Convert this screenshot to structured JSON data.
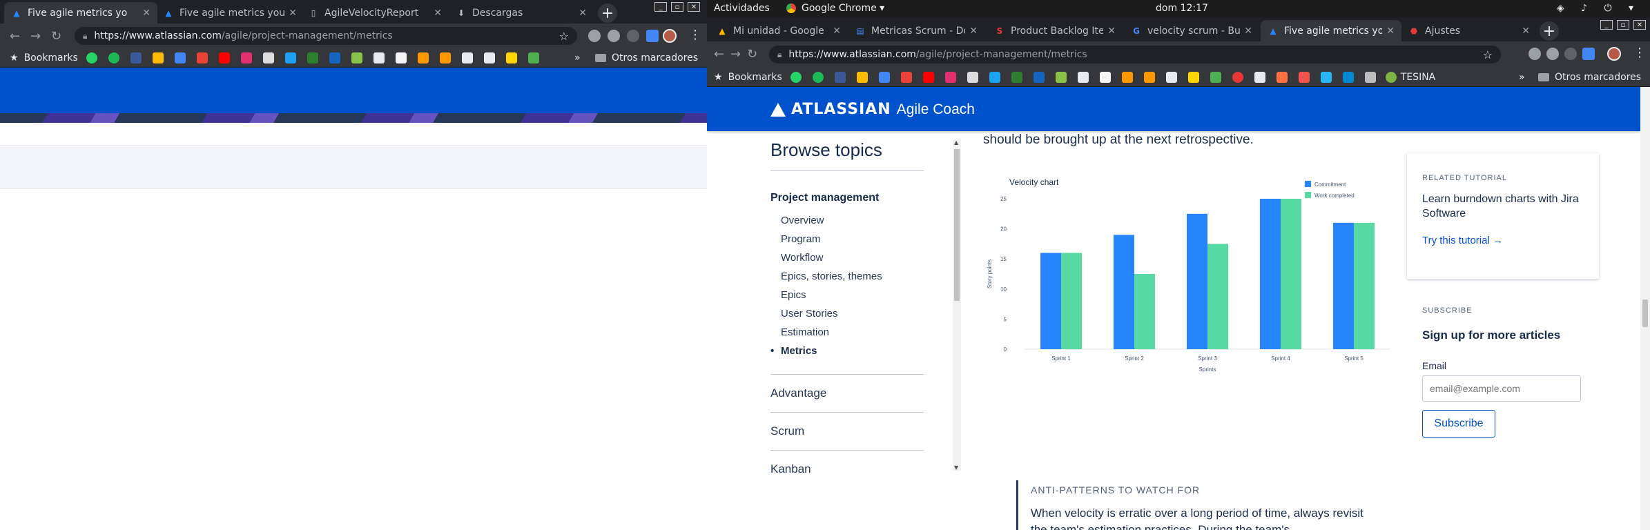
{
  "left_window": {
    "tabs": [
      {
        "title": "Five agile metrics yo",
        "active": true
      },
      {
        "title": "Five agile metrics you",
        "active": false
      },
      {
        "title": "AgileVelocityReport",
        "active": false
      },
      {
        "title": "Descargas",
        "active": false
      }
    ],
    "new_tab_label": "+",
    "url_host": "https://www.atlassian.com",
    "url_path": "/agile/project-management/metrics",
    "bookmarks_label": "Bookmarks",
    "overflow": "»",
    "other_bookmarks": "Otros marcadores"
  },
  "right_window": {
    "system_bar": {
      "activities": "Actividades",
      "app_name": "Google Chrome ▾",
      "clock": "dom 12:17",
      "tray": "◈ ♪ ⏻ ▾"
    },
    "tabs": [
      {
        "title": "Mi unidad - Google",
        "active": false
      },
      {
        "title": "Metricas Scrum - Do",
        "active": false
      },
      {
        "title": "Product Backlog Ite",
        "active": false
      },
      {
        "title": "velocity scrum - Bu",
        "active": false
      },
      {
        "title": "Five agile metrics yo",
        "active": true
      },
      {
        "title": "Ajustes",
        "active": false
      }
    ],
    "new_tab_label": "+",
    "url_host": "https://www.atlassian.com",
    "url_path": "/agile/project-management/metrics",
    "bookmarks_label": "Bookmarks",
    "bookmark_tesina": "TESINA",
    "overflow": "»",
    "other_bookmarks": "Otros marcadores"
  },
  "page": {
    "logo_brand": "ATLASSIAN",
    "logo_product": "Agile Coach",
    "sidebar": {
      "title": "Browse topics",
      "section": "Project management",
      "items": [
        "Overview",
        "Program",
        "Workflow",
        "Epics, stories, themes",
        "Epics",
        "User Stories",
        "Estimation",
        "Metrics"
      ],
      "current_item": "Metrics",
      "categories": [
        "Advantage",
        "Scrum",
        "Kanban"
      ]
    },
    "article_fragment": "should be brought up at the next retrospective.",
    "callout": {
      "title": "ANTI-PATTERNS TO WATCH FOR",
      "body": "When velocity is erratic over a long period of time, always revisit the team's estimation practices. During the team's"
    },
    "related": {
      "label": "RELATED TUTORIAL",
      "title": "Learn burndown charts with Jira Software",
      "link": "Try this tutorial →"
    },
    "subscribe": {
      "label": "SUBSCRIBE",
      "title": "Sign up for more articles",
      "email_label": "Email",
      "email_placeholder": "email@example.com",
      "button": "Subscribe"
    }
  },
  "colors": {
    "atlassian_blue": "#0052cc",
    "commitment": "#2684ff",
    "work_completed": "#57d9a3"
  },
  "chart_data": {
    "type": "bar",
    "title": "Velocity chart",
    "xlabel": "Sprints",
    "ylabel": "Story points",
    "categories": [
      "Sprint 1",
      "Sprint 2",
      "Sprint 3",
      "Sprint 4",
      "Sprint 5"
    ],
    "series": [
      {
        "name": "Commitment",
        "values": [
          16,
          19,
          22.5,
          25,
          21
        ]
      },
      {
        "name": "Work completed",
        "values": [
          16,
          12.5,
          17.5,
          25,
          21
        ]
      }
    ],
    "ylim": [
      0,
      25
    ],
    "yticks": [
      0,
      5,
      10,
      15,
      20,
      25
    ],
    "legend": "top-right",
    "grid": false
  }
}
